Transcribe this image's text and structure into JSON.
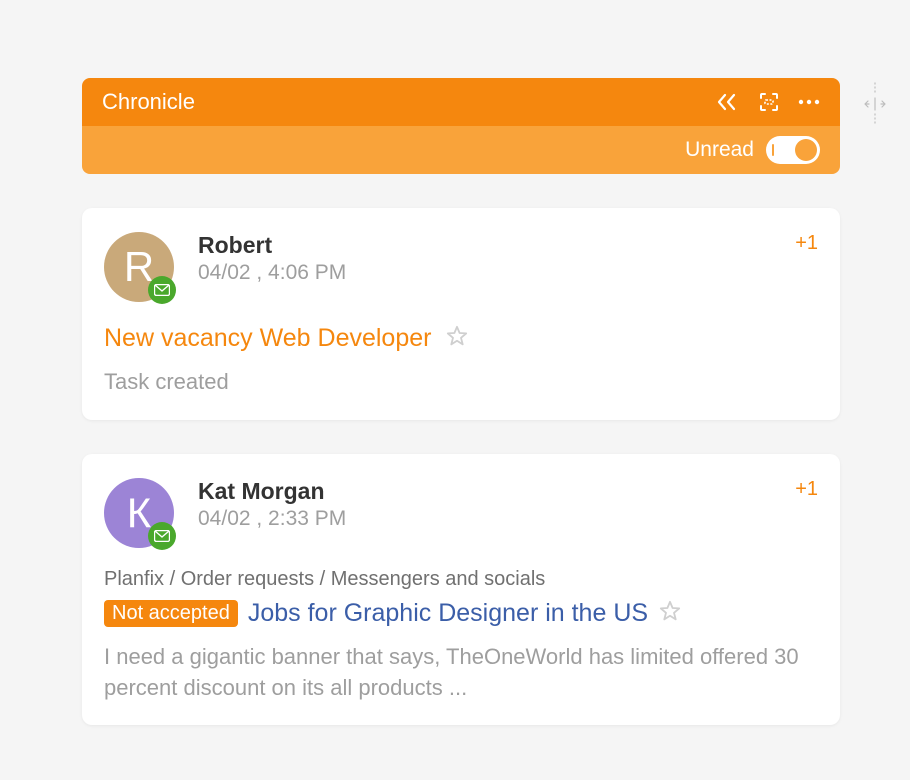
{
  "header": {
    "title": "Chronicle",
    "unread_label": "Unread"
  },
  "entries": [
    {
      "avatar_letter": "R",
      "author": "Robert",
      "timestamp": "04/02 , 4:06 PM",
      "count": "+1",
      "title": "New vacancy Web Developer",
      "body": "Task created"
    },
    {
      "avatar_letter": "К",
      "author": "Kat Morgan",
      "timestamp": "04/02 , 2:33 PM",
      "count": "+1",
      "breadcrumb": "Planfix / Order requests / Messengers and socials",
      "badge": "Not accepted",
      "title": "Jobs for Graphic Designer in the US",
      "body": "I need a gigantic banner that says, TheOneWorld has limited offered 30 percent discount on its all products ..."
    }
  ]
}
